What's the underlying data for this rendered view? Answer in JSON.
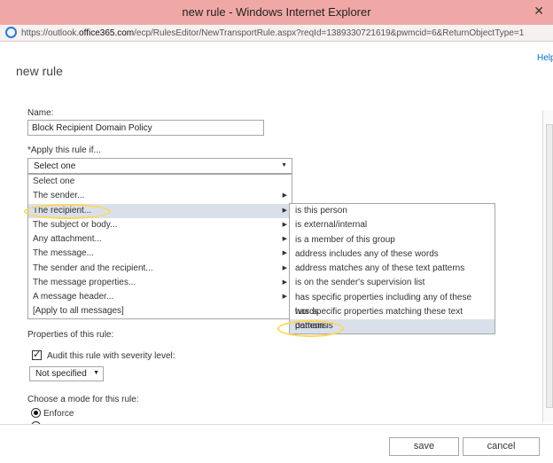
{
  "window": {
    "title": "new rule - Windows Internet Explorer",
    "url_prefix": "https://outlook.",
    "url_host": "office365.com",
    "url_rest": "/ecp/RulesEditor/NewTransportRule.aspx?reqId=1389330721619&pwmcid=6&ReturnObjectType=1"
  },
  "page": {
    "title": "new rule",
    "help": "Help"
  },
  "form": {
    "name_label": "Name:",
    "name_value": "Block Recipient Domain Policy",
    "apply_label": "*Apply this rule if...",
    "apply_selected": "Select one",
    "conditions": [
      "Select one",
      "The sender...",
      "The recipient...",
      "The subject or body...",
      "Any attachment...",
      "The message...",
      "The sender and the recipient...",
      "The message properties...",
      "A message header...",
      "[Apply to all messages]"
    ],
    "recipient_options": [
      "is this person",
      "is external/internal",
      "is a member of this group",
      "address includes any of these words",
      "address matches any of these text patterns",
      "is on the sender's supervision list",
      "has specific properties including any of these words",
      "has specific properties matching these text patterns",
      "domain is"
    ],
    "properties_label": "Properties of this rule:",
    "audit_label": "Audit this rule with severity level:",
    "severity_value": "Not specified",
    "mode_label": "Choose a mode for this rule:",
    "mode_enforce": "Enforce"
  },
  "buttons": {
    "save": "save",
    "cancel": "cancel"
  },
  "colors": {
    "titlebar": "#f0a8a6",
    "highlight_ring": "#ffd65c",
    "hover_row": "#d9e0ea",
    "link": "#0072c6"
  }
}
